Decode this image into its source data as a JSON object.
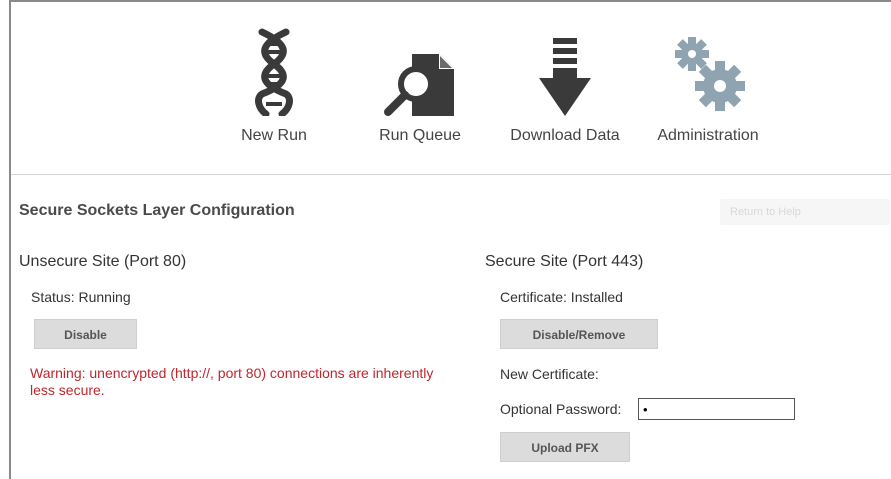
{
  "nav": {
    "items": [
      {
        "label": "New Run",
        "icon": "dna-icon"
      },
      {
        "label": "Run Queue",
        "icon": "search-document-icon"
      },
      {
        "label": "Download Data",
        "icon": "download-arrow-icon"
      },
      {
        "label": "Administration",
        "icon": "gears-icon"
      }
    ]
  },
  "page": {
    "title": "Secure Sockets Layer Configuration",
    "help_text": "Return to Help"
  },
  "unsecure": {
    "title": "Unsecure Site (Port 80)",
    "status": "Status: Running",
    "disable_label": "Disable",
    "warning": "Warning: unencrypted (http://, port 80) connections are inherently less secure."
  },
  "secure": {
    "title": "Secure Site (Port 443)",
    "certificate_status": "Certificate: Installed",
    "disable_remove_label": "Disable/Remove",
    "new_certificate_label": "New Certificate:",
    "password_label": "Optional Password:",
    "password_value": "•",
    "upload_label": "Upload PFX"
  },
  "colors": {
    "icon_dark": "#3a3a3a",
    "icon_gear": "#8fa3b0",
    "warning": "#c0262d",
    "button_bg": "#dcdcdc"
  }
}
